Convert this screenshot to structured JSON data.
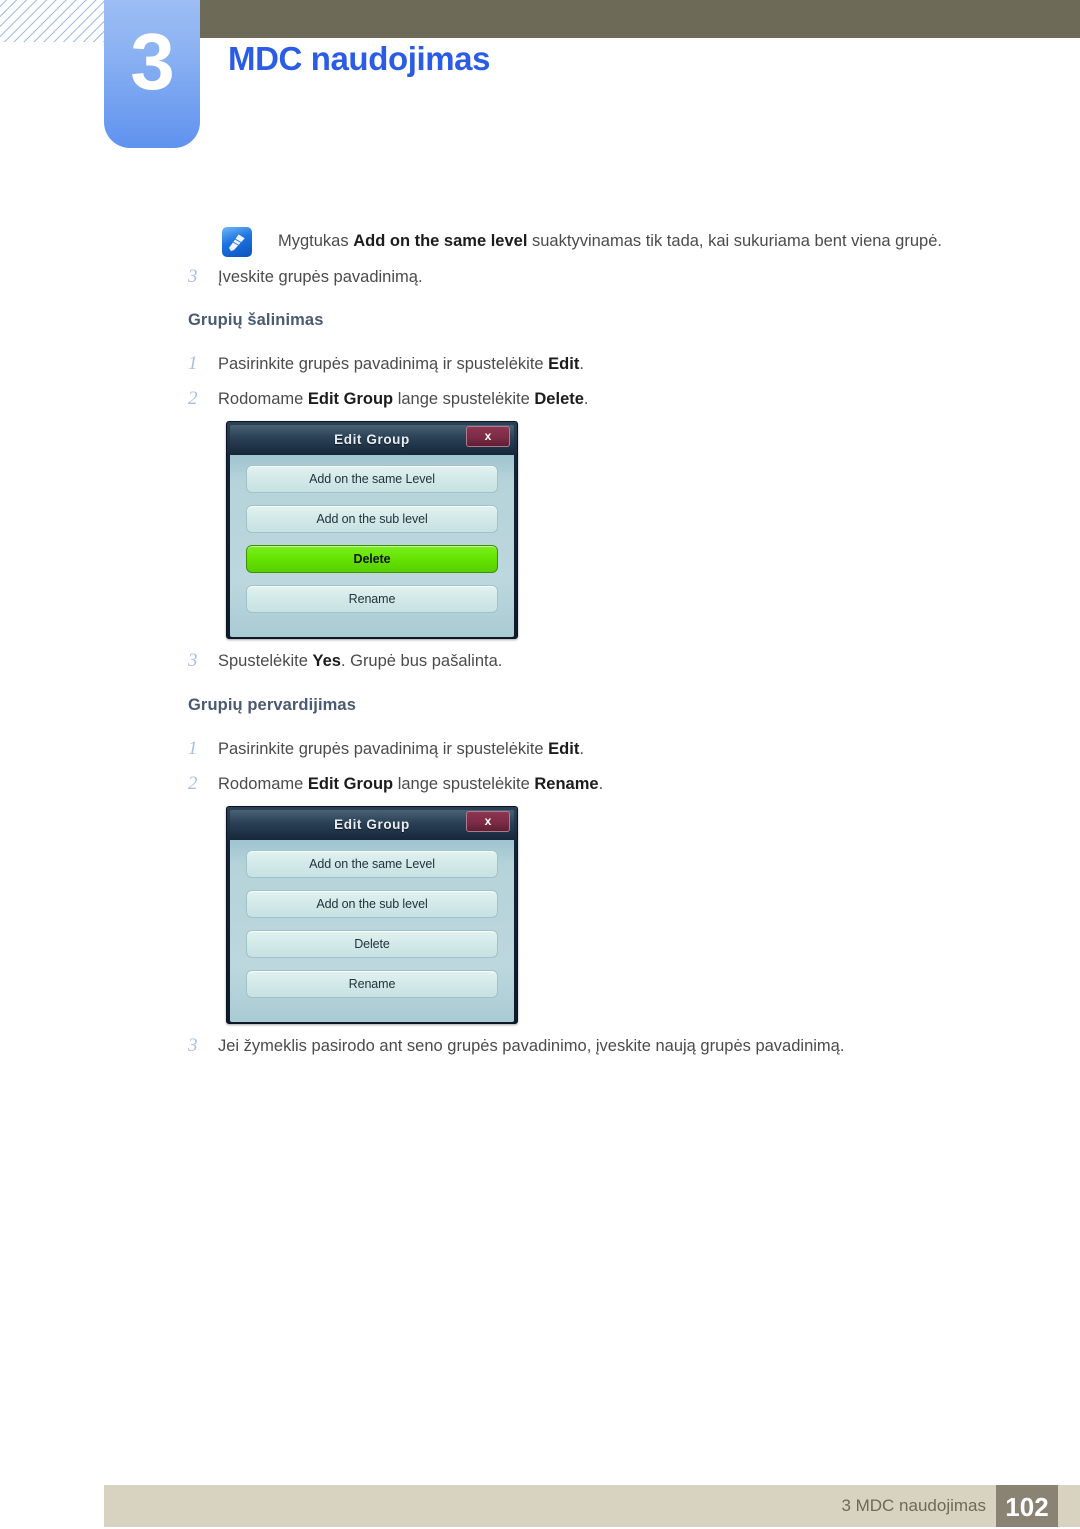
{
  "header": {
    "chapter_number": "3",
    "chapter_title": "MDC naudojimas"
  },
  "note": {
    "icon": "note-pen-icon",
    "prefix": "Mygtukas ",
    "bold": "Add on the same level",
    "suffix": " suaktyvinamas tik tada, kai sukuriama bent viena grupė."
  },
  "steps": {
    "intro_step": {
      "num": "3",
      "text": "Įveskite grupės pavadinimą."
    },
    "delete_section": {
      "heading": "Grupių šalinimas",
      "items": [
        {
          "num": "1",
          "pre": "Pasirinkite grupės pavadinimą ir spustelėkite ",
          "bold": "Edit",
          "post": "."
        },
        {
          "num": "2",
          "pre": "Rodomame ",
          "bold": "Edit Group",
          "mid": " lange spustelėkite ",
          "bold2": "Delete",
          "post": "."
        },
        {
          "num": "3",
          "pre": "Spustelėkite ",
          "bold": "Yes",
          "post": ". Grupė bus pašalinta."
        }
      ]
    },
    "rename_section": {
      "heading": "Grupių pervardijimas",
      "items": [
        {
          "num": "1",
          "pre": "Pasirinkite grupės pavadinimą ir spustelėkite ",
          "bold": "Edit",
          "post": "."
        },
        {
          "num": "2",
          "pre": "Rodomame ",
          "bold": "Edit Group",
          "mid": " lange spustelėkite ",
          "bold2": "Rename",
          "post": "."
        },
        {
          "num": "3",
          "pre": "Jei žymeklis pasirodo ant seno grupės pavadinimo, įveskite naują grupės pavadinimą.",
          "bold": "",
          "post": ""
        }
      ]
    }
  },
  "dialog_delete": {
    "title": "Edit Group",
    "close_label": "x",
    "buttons": [
      {
        "label": "Add on the same Level",
        "highlighted": false
      },
      {
        "label": "Add on the sub level",
        "highlighted": false
      },
      {
        "label": "Delete",
        "highlighted": true
      },
      {
        "label": "Rename",
        "highlighted": false
      }
    ]
  },
  "dialog_rename": {
    "title": "Edit Group",
    "close_label": "x",
    "buttons": [
      {
        "label": "Add on the same Level",
        "highlighted": false
      },
      {
        "label": "Add on the sub level",
        "highlighted": false
      },
      {
        "label": "Delete",
        "highlighted": false
      },
      {
        "label": "Rename",
        "highlighted": false
      }
    ]
  },
  "footer": {
    "label": "3 MDC naudojimas",
    "page_number": "102"
  },
  "colors": {
    "header_band": "#6e6a58",
    "chapter_tab": "#7fa9f0",
    "chapter_title": "#2b5ce6",
    "step_number": "#a8bde4",
    "sub_heading": "#4a5a72",
    "body_text": "#4b4b4b",
    "footer_bar": "#d8d3c1",
    "footer_page_box": "#8a8374",
    "dialog_titlebar": "#2c4257",
    "dialog_body": "#bcd7dd",
    "dialog_button": "#d2e9e8",
    "dialog_highlight": "#63e300",
    "dialog_close": "#7c2c46"
  }
}
